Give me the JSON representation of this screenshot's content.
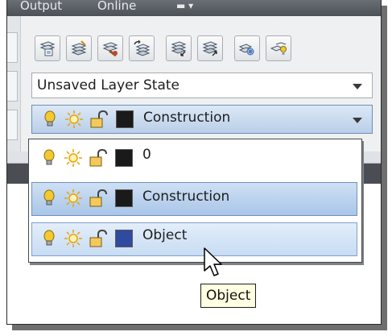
{
  "ribbon": {
    "tabs": [
      {
        "label": "Output"
      },
      {
        "label": "Online"
      }
    ]
  },
  "toolbar": {
    "buttons": [
      {
        "icon": "layer-properties-icon"
      },
      {
        "icon": "layer-states-icon"
      },
      {
        "icon": "layer-match-icon"
      },
      {
        "icon": "layer-previous-icon"
      },
      {
        "icon": "layer-isolate-icon"
      },
      {
        "icon": "layer-unisolate-icon"
      },
      {
        "icon": "layer-freeze-icon"
      },
      {
        "icon": "layer-off-icon"
      }
    ]
  },
  "layer_state": {
    "value": "Unsaved Layer State"
  },
  "layer_dropdown": {
    "selected": {
      "name": "Construction",
      "color": "#1a1a1a"
    },
    "items": [
      {
        "name": "0",
        "color": "#1a1a1a"
      },
      {
        "name": "Construction",
        "color": "#1a1a1a"
      },
      {
        "name": "Object",
        "color": "#2f4a9e"
      }
    ]
  },
  "tooltip": {
    "text": "Object"
  },
  "colors": {
    "selection": "#b9cfe9",
    "hover": "#c8dcf3",
    "tooltip_bg": "#ffffe1",
    "bulb": "#f2c930",
    "sun": "#e8a20a"
  }
}
